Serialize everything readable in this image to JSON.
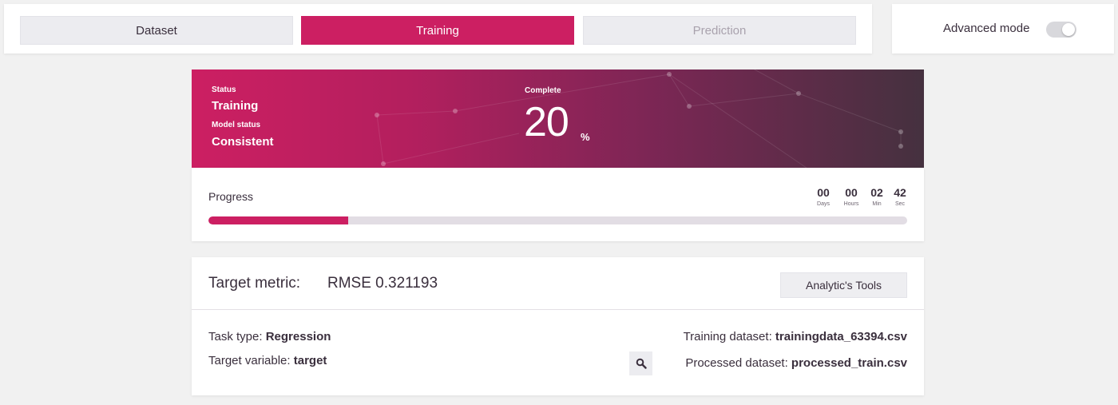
{
  "tabs": [
    {
      "label": "Dataset",
      "state": "default"
    },
    {
      "label": "Training",
      "state": "active"
    },
    {
      "label": "Prediction",
      "state": "disabled"
    }
  ],
  "advanced_mode": {
    "label": "Advanced mode",
    "enabled": false
  },
  "hero": {
    "status_label": "Status",
    "status_value": "Training",
    "model_status_label": "Model status",
    "model_status_value": "Consistent",
    "complete_label": "Complete",
    "complete_value": "20",
    "complete_unit": "%"
  },
  "progress": {
    "title": "Progress",
    "fraction": 0.2,
    "timer": [
      {
        "value": "00",
        "unit": "Days"
      },
      {
        "value": "00",
        "unit": "Hours"
      },
      {
        "value": "02",
        "unit": "Min"
      },
      {
        "value": "42",
        "unit": "Sec"
      }
    ]
  },
  "metric": {
    "label": "Target metric:",
    "value": "RMSE 0.321193",
    "tools_button": "Analytic's Tools"
  },
  "details": {
    "task_type_label": "Task type: ",
    "task_type_value": "Regression",
    "target_variable_label": "Target variable: ",
    "target_variable_value": "target",
    "training_dataset_label": "Training dataset: ",
    "training_dataset_value": "trainingdata_63394.csv",
    "processed_dataset_label": "Processed dataset: ",
    "processed_dataset_value": "processed_train.csv"
  },
  "colors": {
    "accent": "#cc1f62",
    "hero_end": "#45313f",
    "background": "#f1f1f1"
  },
  "icons": {
    "search": "search-icon"
  }
}
